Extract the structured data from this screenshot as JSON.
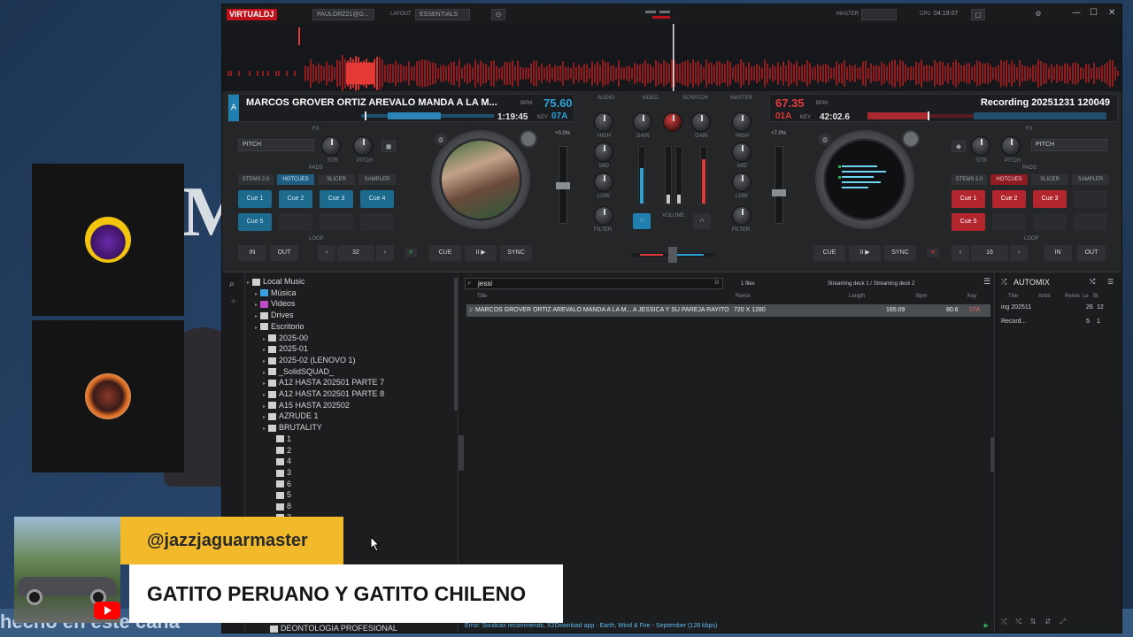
{
  "app": {
    "logo": "VIRTUALDJ",
    "user": "PAULORZ21@G...",
    "layout_label": "LAYOUT",
    "layout_value": "ESSENTIALS",
    "master_label": "MASTER",
    "cpu_label": "CPU",
    "clock": "04:19:07"
  },
  "colors": {
    "deck_left": "#2aa3d8",
    "deck_right": "#e03a3a",
    "accent_yellow": "#f2b92b"
  },
  "deck_left": {
    "title": "MARCOS GROVER ORTIZ AREVALO MANDA A LA M...",
    "bpm": "75.60",
    "bpm_label": "BPM",
    "time": "1:19:45",
    "key_label": "KEY",
    "key": "07A",
    "pitch_label": "+0.0%",
    "fx_label": "FX",
    "fx_select": "PITCH",
    "str_label": "STR",
    "pitch_knob_label": "PITCH",
    "pads_label": "PADS",
    "modes": [
      "STEMS 2.0",
      "HOTCUES",
      "SLICER",
      "SAMPLER"
    ],
    "pads": [
      "Cue 1",
      "Cue 2",
      "Cue 3",
      "Cue 4",
      "Cue 5"
    ],
    "loop_label": "LOOP",
    "in": "IN",
    "out": "OUT",
    "loop_value": "32",
    "cue": "CUE",
    "play": "II ▶",
    "sync": "SYNC"
  },
  "deck_right": {
    "title": "Recording 20251231 120049",
    "bpm": "67.35",
    "bpm_label": "BPM",
    "time": "42:02.6",
    "key_label": "KEY",
    "key": "01A",
    "pitch_label": "+7.0%",
    "fx_label": "FX",
    "fx_select": "PITCH",
    "str_label": "STR",
    "pitch_knob_label": "PITCH",
    "pads_label": "PADS",
    "modes": [
      "STEMS 2.0",
      "HOTCUES",
      "SLICER",
      "SAMPLER"
    ],
    "pads": [
      "Cue 1",
      "Cue 2",
      "Cue 3",
      "Cue 5"
    ],
    "loop_label": "LOOP",
    "in": "IN",
    "out": "OUT",
    "loop_value": "16",
    "cue": "CUE",
    "play": "II ▶",
    "sync": "SYNC"
  },
  "mixer": {
    "labels": [
      "AUDIO",
      "VIDEO",
      "SCRATCH",
      "MASTER"
    ],
    "gain": "GAIN",
    "high": "HIGH",
    "mid": "MID",
    "low": "LOW",
    "filter": "FILTER",
    "volume": "VOLUME"
  },
  "browser": {
    "tree": [
      {
        "label": "Local Music",
        "level": 0
      },
      {
        "label": "Música",
        "level": 1
      },
      {
        "label": "Videos",
        "level": 1
      },
      {
        "label": "Drives",
        "level": 1
      },
      {
        "label": "Escritorio",
        "level": 1
      },
      {
        "label": "2025-00",
        "level": 2
      },
      {
        "label": "2025-01",
        "level": 2
      },
      {
        "label": "2025-02 (LENOVO 1)",
        "level": 2
      },
      {
        "label": "_SolidSQUAD_",
        "level": 2
      },
      {
        "label": "A12 HASTA 202501 PARTE 7",
        "level": 2
      },
      {
        "label": "A12 HASTA 202501 PARTE 8",
        "level": 2
      },
      {
        "label": "A15 HASTA 202502",
        "level": 2
      },
      {
        "label": "AZRUDE 1",
        "level": 2
      },
      {
        "label": "BRUTALITY",
        "level": 2
      },
      {
        "label": "1",
        "level": 3
      },
      {
        "label": "2",
        "level": 3
      },
      {
        "label": "4",
        "level": 3
      },
      {
        "label": "3",
        "level": 3
      },
      {
        "label": "6",
        "level": 3
      },
      {
        "label": "5",
        "level": 3
      },
      {
        "label": "8",
        "level": 3
      },
      {
        "label": "7",
        "level": 3
      }
    ],
    "tree_bottom": "DEONTOLOGIA PROFESIONAL",
    "search": "jessi",
    "file_count": "1 files",
    "streaming": "Streaming deck 1 / Streaming deck 2",
    "columns": [
      "Title",
      "Remix",
      "Length",
      "Bpm",
      "Key"
    ],
    "rows": [
      {
        "title": "MARCOS GROVER ORTIZ AREVALO MANDA A LA M... A JESSICA Y SU PAREJA RAYITO",
        "remix": "720 X 1280",
        "length": "165:09",
        "bpm": "80.6",
        "key": "07A"
      }
    ],
    "status": "Error: Soudcax recommends, X2Download app - Earth, Wind & Fire - September (128 kbps)"
  },
  "automix": {
    "title": "AUTOMIX",
    "columns": [
      "Title",
      "Artist",
      "Remix",
      "Le",
      "Bt"
    ],
    "rows": [
      {
        "title": "ing 202511",
        "c1": "26",
        "c2": "12"
      },
      {
        "title": "Record...",
        "c1": "5",
        "c2": "1"
      }
    ]
  },
  "overlay": {
    "handle": "@jazzjaguarmaster",
    "message": "GATITO PERUANO Y GATITO CHILENO",
    "ticker": "hecho en este cana"
  }
}
